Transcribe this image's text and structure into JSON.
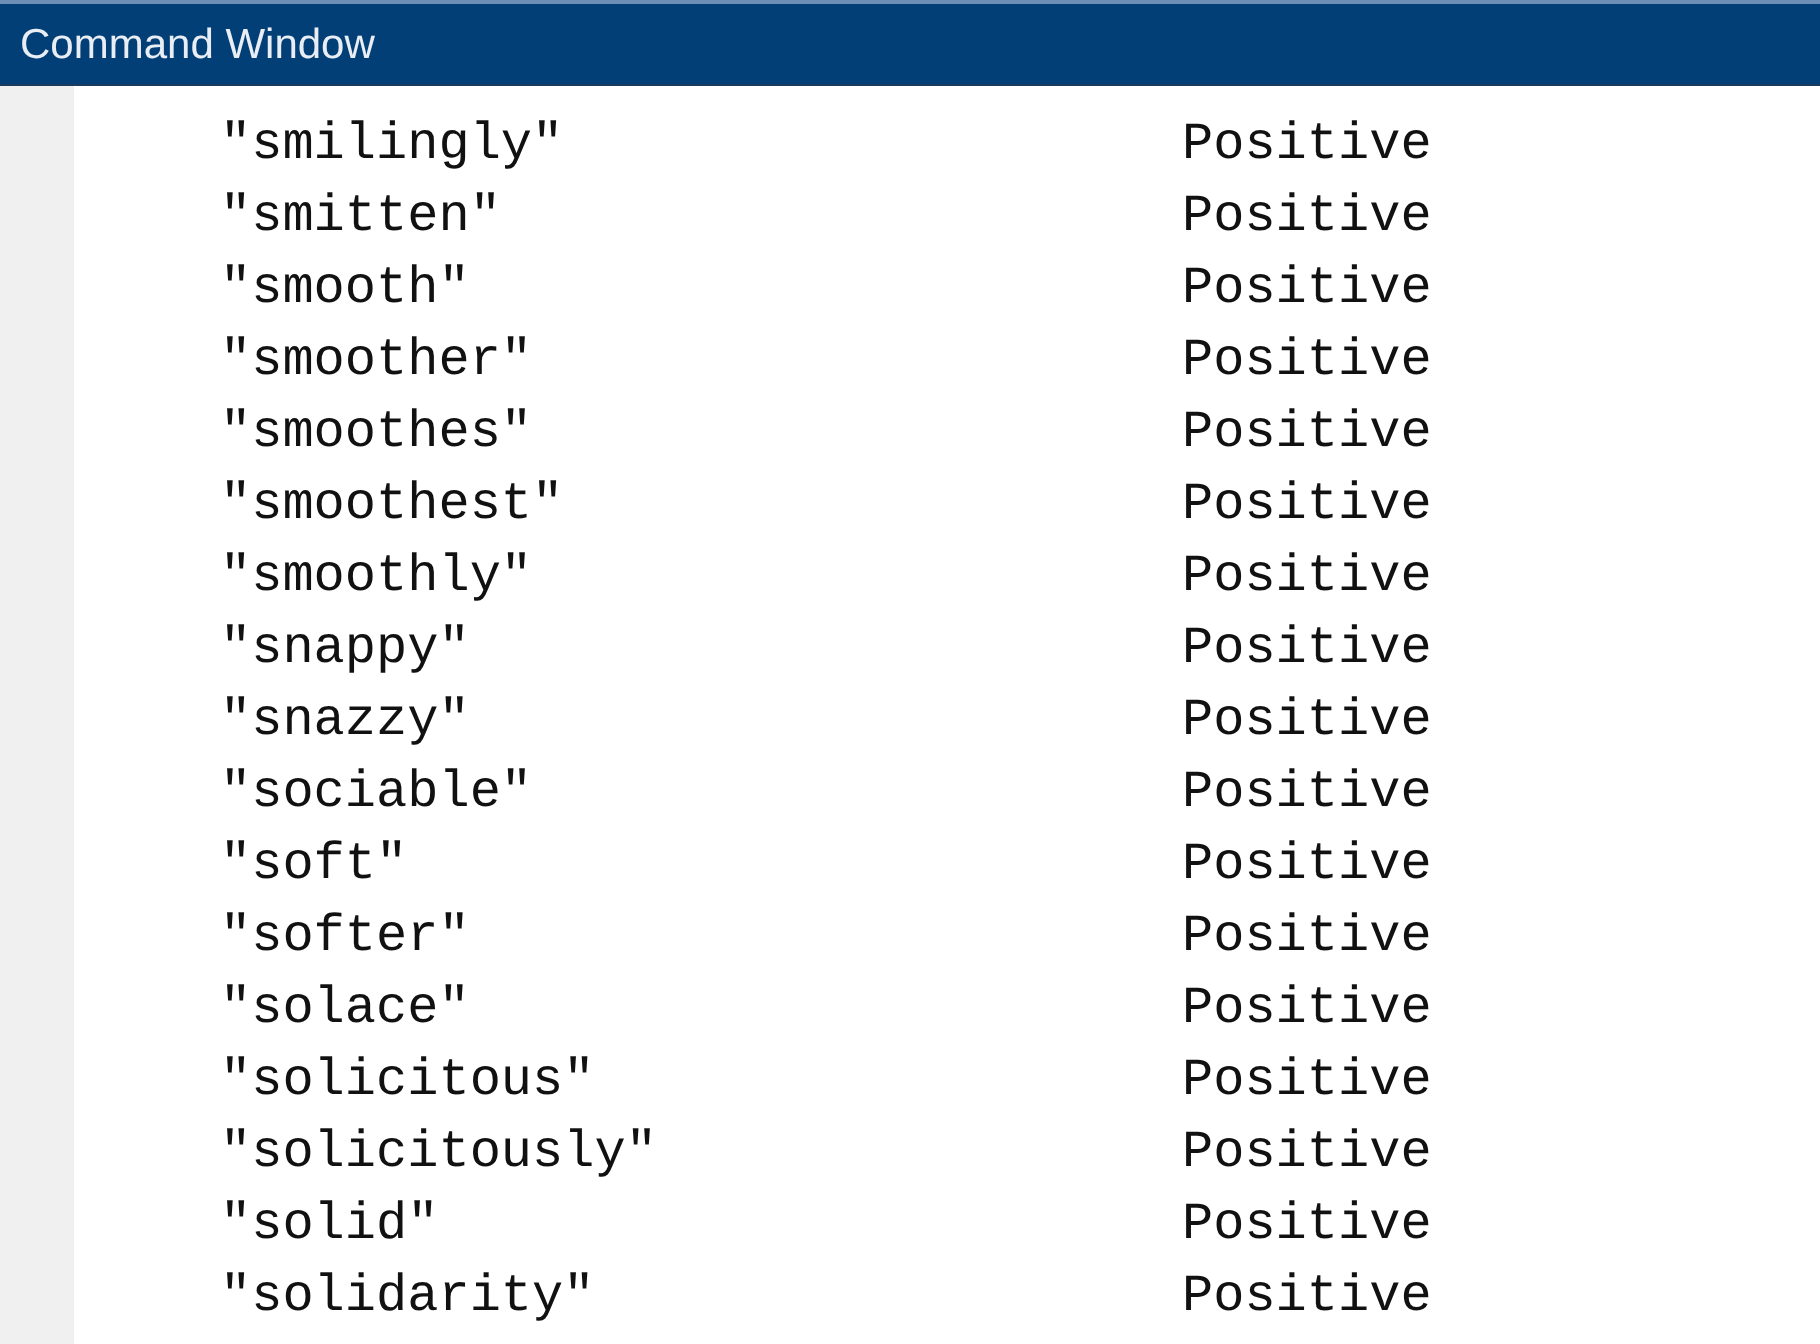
{
  "panel": {
    "title": "Command Window"
  },
  "rows": [
    {
      "word": "\"smilingly\"",
      "label": "Positive"
    },
    {
      "word": "\"smitten\"",
      "label": "Positive"
    },
    {
      "word": "\"smooth\"",
      "label": "Positive"
    },
    {
      "word": "\"smoother\"",
      "label": "Positive"
    },
    {
      "word": "\"smoothes\"",
      "label": "Positive"
    },
    {
      "word": "\"smoothest\"",
      "label": "Positive"
    },
    {
      "word": "\"smoothly\"",
      "label": "Positive"
    },
    {
      "word": "\"snappy\"",
      "label": "Positive"
    },
    {
      "word": "\"snazzy\"",
      "label": "Positive"
    },
    {
      "word": "\"sociable\"",
      "label": "Positive"
    },
    {
      "word": "\"soft\"",
      "label": "Positive"
    },
    {
      "word": "\"softer\"",
      "label": "Positive"
    },
    {
      "word": "\"solace\"",
      "label": "Positive"
    },
    {
      "word": "\"solicitous\"",
      "label": "Positive"
    },
    {
      "word": "\"solicitously\"",
      "label": "Positive"
    },
    {
      "word": "\"solid\"",
      "label": "Positive"
    },
    {
      "word": "\"solidarity\"",
      "label": "Positive"
    }
  ]
}
